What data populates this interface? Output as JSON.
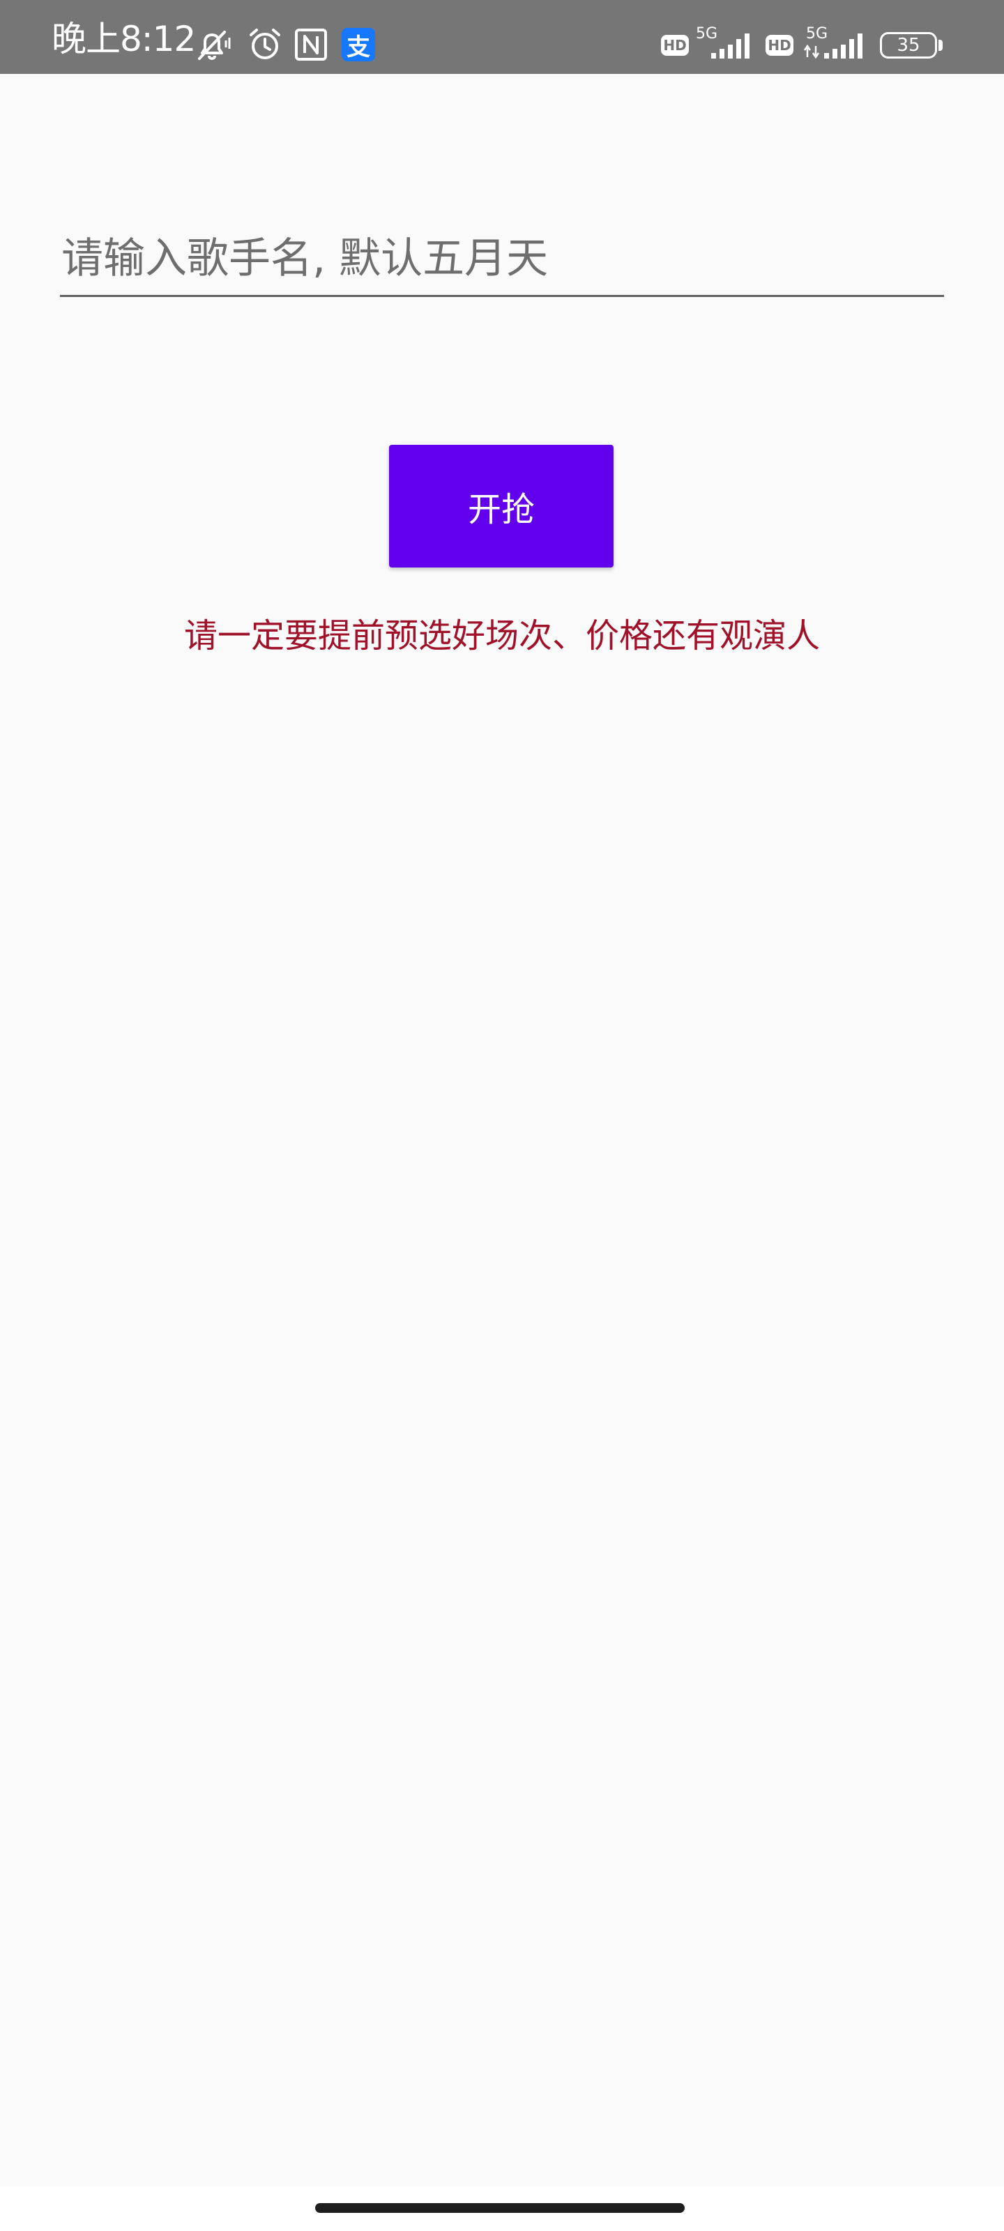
{
  "status_bar": {
    "time": "晚上8:12",
    "alipay_glyph": "支",
    "hd_label": "HD",
    "network_label": "5G",
    "battery_level": "35",
    "icons": [
      "mute-icon",
      "alarm-icon",
      "nfc-icon",
      "alipay-icon",
      "hd-icon",
      "signal-icon",
      "battery-icon"
    ]
  },
  "form": {
    "singer_input_placeholder": "请输入歌手名, 默认五月天",
    "singer_input_value": "",
    "start_button_label": "开抢"
  },
  "hint": {
    "text": "请一定要提前预选好场次、价格还有观演人"
  },
  "colors": {
    "status_bar_bg": "#767676",
    "page_bg": "#fafafa",
    "button_bg": "#6200ee",
    "hint_color": "#a0112a"
  }
}
